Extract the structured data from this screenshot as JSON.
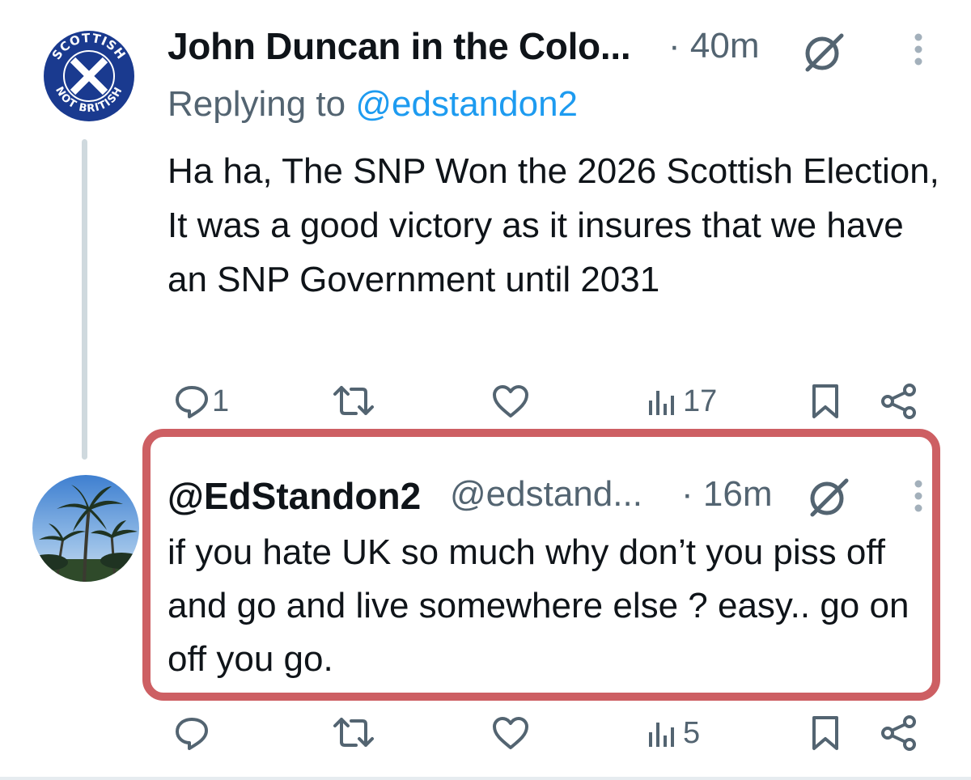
{
  "tweets": [
    {
      "display_name": "John Duncan in the Colo...",
      "time": "· 40m",
      "reply_prefix": "Replying to",
      "reply_handle": "@edstandon2",
      "text": "Ha ha, The SNP Won the 2026 Scottish Election, It was a good victory as it insures that we have an SNP Government until 2031",
      "avatar_text_top": "SCOTTISH",
      "avatar_text_bottom": "NOT BRITISH",
      "stats": {
        "replies": "1",
        "views": "17"
      }
    },
    {
      "display_name": "@EdStandon2",
      "handle": "@edstand...",
      "time": "· 16m",
      "text": "if you hate UK so much why don’t you piss off and go and live somewhere else ? easy.. go on off you go.",
      "stats": {
        "views": "5"
      }
    }
  ],
  "colors": {
    "text": "#0f1419",
    "secondary": "#536471",
    "link": "#1d9bf0",
    "highlight_border": "#cd5f63",
    "thread_line": "#cfd9de",
    "saltire_blue": "#1a3a8f"
  },
  "icons": [
    "reply-icon",
    "retweet-icon",
    "like-icon",
    "views-icon",
    "bookmark-icon",
    "share-icon",
    "grok-icon",
    "more-icon"
  ]
}
